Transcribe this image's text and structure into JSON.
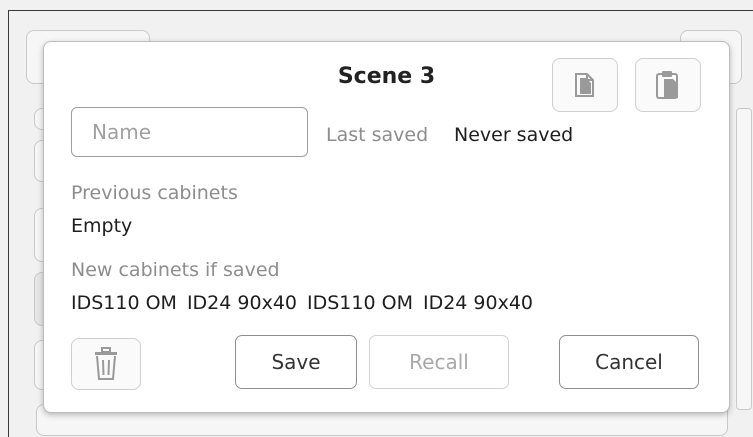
{
  "dialog": {
    "title": "Scene 3",
    "name_placeholder": "Name",
    "name_value": "",
    "last_saved_label": "Last saved",
    "last_saved_value": "Never saved",
    "previous_cabinets_label": "Previous cabinets",
    "previous_cabinets_value": "Empty",
    "new_cabinets_label": "New cabinets if saved",
    "new_cabinets": [
      "IDS110 OM",
      "ID24 90x40",
      "IDS110 OM",
      "ID24 90x40"
    ],
    "buttons": {
      "save": "Save",
      "recall": "Recall",
      "cancel": "Cancel"
    },
    "icons": {
      "copy": "copy-icon",
      "paste": "paste-icon",
      "delete": "trash-icon"
    }
  }
}
